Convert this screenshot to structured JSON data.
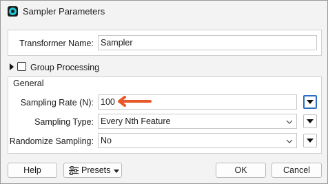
{
  "window": {
    "title": "Sampler Parameters"
  },
  "transformer": {
    "label": "Transformer Name:",
    "value": "Sampler"
  },
  "group_processing": {
    "label": "Group Processing",
    "checked": false
  },
  "general": {
    "heading": "General",
    "sampling_rate": {
      "label": "Sampling Rate (N):",
      "value": "100"
    },
    "sampling_type": {
      "label": "Sampling Type:",
      "value": "Every Nth Feature"
    },
    "randomize": {
      "label": "Randomize Sampling:",
      "value": "No"
    }
  },
  "buttons": {
    "help": "Help",
    "presets": "Presets",
    "ok": "OK",
    "cancel": "Cancel"
  },
  "annotation": {
    "arrow_color": "#e8592a"
  }
}
